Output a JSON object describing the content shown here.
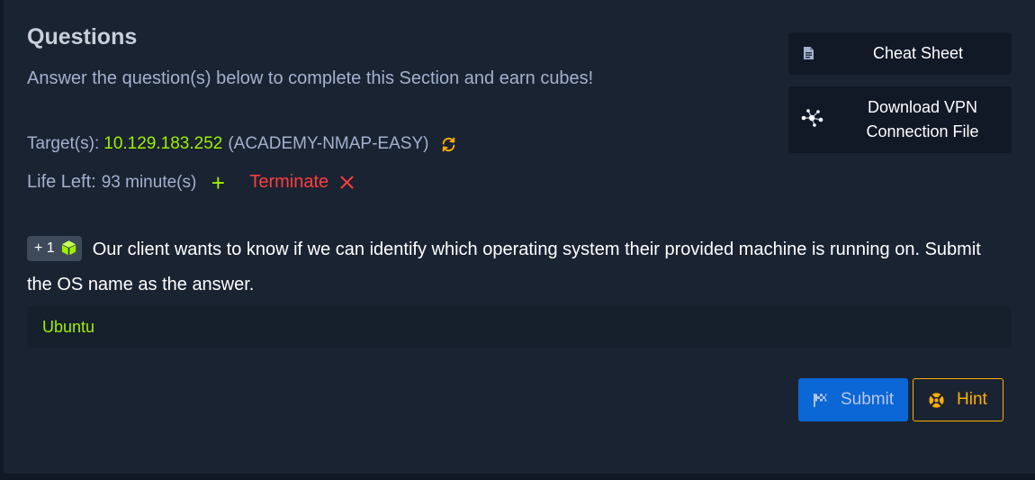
{
  "section": {
    "title": "Questions",
    "subtitle": "Answer the question(s) below to complete this Section and earn cubes!"
  },
  "target": {
    "label": "Target(s):",
    "ip": "10.129.183.252",
    "hostname": "(ACADEMY-NMAP-EASY)",
    "reset_icon": "refresh-icon"
  },
  "life": {
    "label": "Life Left:",
    "value": "93 minute(s)",
    "extend_symbol": "+",
    "terminate_label": "Terminate"
  },
  "sidebar": {
    "cheat_sheet_label": "Cheat Sheet",
    "vpn_label_line1": "Download VPN",
    "vpn_label_line2": "Connection File"
  },
  "question": {
    "reward": "+ 1",
    "reward_icon": "cube-icon",
    "text": "Our client wants to know if we can identify which operating system their provided machine is running on. Submit the OS name as the answer."
  },
  "answer": {
    "value": "Ubuntu"
  },
  "actions": {
    "submit_label": "Submit",
    "hint_label": "Hint"
  },
  "colors": {
    "background": "#1a2332",
    "accent_green": "#9fef00",
    "danger_red": "#ff3e3e",
    "hint_orange": "#ffaf00",
    "submit_blue": "#0b66d6"
  }
}
